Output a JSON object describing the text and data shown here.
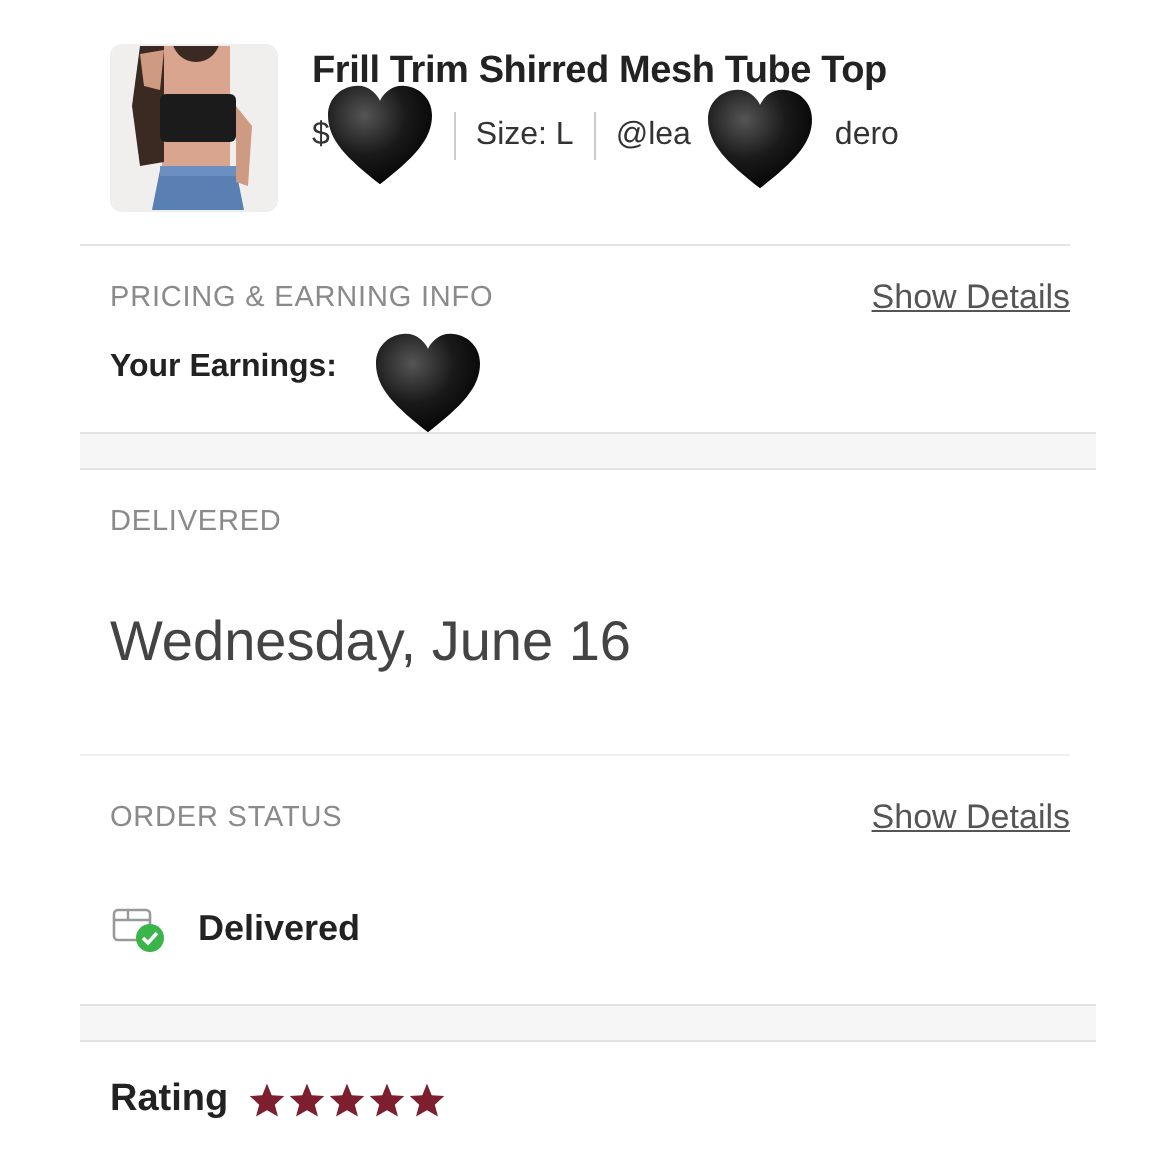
{
  "item": {
    "kind": "picture",
    "title": "Frill Trim Shirred Mesh Tube Top",
    "price": "$",
    "size": "Size: L",
    "seller_start": "@lea",
    "seller_end": "dero"
  },
  "pricing": {
    "heading": "PRICING & EARNING INFO",
    "link": "Show Details",
    "earnings": "Your Earnings:"
  },
  "delivery": {
    "heading": "DELIVERED",
    "date": "Wednesday, June 16"
  },
  "order_status": {
    "heading": "ORDER STATUS",
    "link": "Show Details",
    "status": "Delivered"
  },
  "rating": {
    "label": "Rating",
    "stars": 5
  }
}
